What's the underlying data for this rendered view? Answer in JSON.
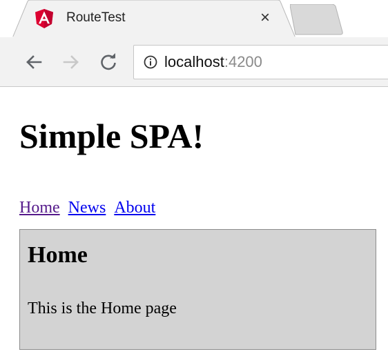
{
  "browser": {
    "tab": {
      "title": "RouteTest",
      "close_symbol": "×",
      "favicon": "angular-icon"
    },
    "toolbar": {
      "back_icon": "arrow-left-icon",
      "forward_icon": "arrow-right-icon",
      "reload_icon": "reload-icon"
    },
    "address": {
      "host": "localhost",
      "port": ":4200",
      "info_icon": "info-icon"
    }
  },
  "page": {
    "title": "Simple SPA!",
    "nav": [
      {
        "label": "Home"
      },
      {
        "label": "News"
      },
      {
        "label": "About"
      }
    ],
    "view": {
      "heading": "Home",
      "text": "This is the Home page"
    }
  },
  "colors": {
    "chrome_bg": "#f2f2f2",
    "link": "#0000ee",
    "link_visited": "#551a8b",
    "view_bg": "#d3d3d3",
    "angular_red": "#dd0031"
  }
}
